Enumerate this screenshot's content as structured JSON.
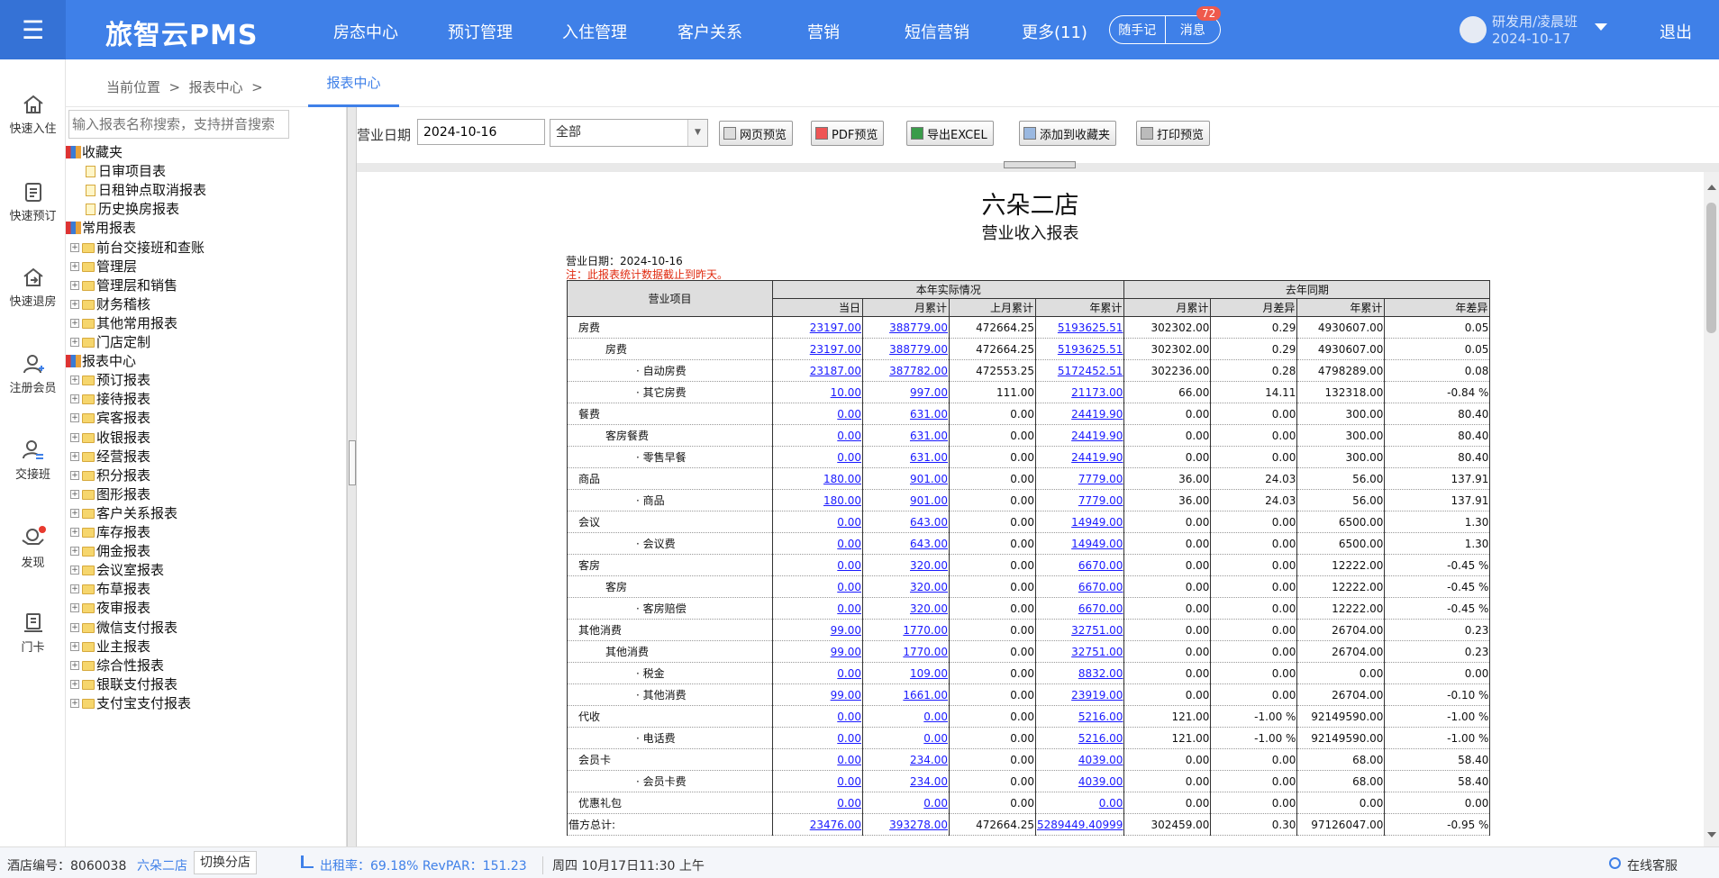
{
  "topbar": {
    "logo": "旅智云PMS",
    "nav": [
      "房态中心",
      "预订管理",
      "入住管理",
      "客户关系",
      "营销",
      "短信营销",
      "更多(11)"
    ],
    "memo_label": "随手记",
    "message_label": "消息",
    "message_count": "72",
    "user_name": "研发用/凌晨班",
    "user_date": "2024-10-17",
    "logout_label": "退出"
  },
  "leftnav": [
    {
      "label": "快速入住",
      "icon": "home-icon"
    },
    {
      "label": "快速预订",
      "icon": "clipboard-icon"
    },
    {
      "label": "快速退房",
      "icon": "checkout-icon"
    },
    {
      "label": "注册会员",
      "icon": "add-user-icon"
    },
    {
      "label": "交接班",
      "icon": "shift-icon"
    },
    {
      "label": "发现",
      "icon": "discover-icon"
    },
    {
      "label": "门卡",
      "icon": "card-icon"
    }
  ],
  "breadcrumb": {
    "text": "当前位置  >  报表中心  >",
    "active_tab": "报表中心"
  },
  "tree": {
    "search_placeholder": "输入报表名称搜索，支持拼音搜索",
    "favorites_label": "收藏夹",
    "favorites": [
      "日审项目表",
      "日租钟点取消报表",
      "历史换房报表"
    ],
    "common_label": "常用报表",
    "common": [
      "前台交接班和查账",
      "管理层",
      "管理层和销售",
      "财务稽核",
      "其他常用报表",
      "门店定制"
    ],
    "center_label": "报表中心",
    "center": [
      "预订报表",
      "接待报表",
      "宾客报表",
      "收银报表",
      "经营报表",
      "积分报表",
      "图形报表",
      "客户关系报表",
      "库存报表",
      "佣金报表",
      "会议室报表",
      "布草报表",
      "夜审报表",
      "微信支付报表",
      "业主报表",
      "综合性报表",
      "银联支付报表",
      "支付宝支付报表"
    ]
  },
  "toolbar": {
    "date_label": "营业日期",
    "date_value": "2024-10-16",
    "select_value": "全部",
    "buttons": [
      "网页预览",
      "PDF预览",
      "导出EXCEL",
      "添加到收藏夹",
      "打印预览"
    ]
  },
  "report": {
    "title": "六朵二店",
    "subtitle": "营业收入报表",
    "date_line": "营业日期：2024-10-16",
    "note": "注：此报表统计数据截止到昨天。",
    "header": {
      "item": "营业项目",
      "current_group": "本年实际情况",
      "last_group": "去年同期",
      "cols": [
        "当日",
        "月累计",
        "上月累计",
        "年累计",
        "月累计",
        "月差异",
        "年累计",
        "年差异"
      ]
    },
    "rows": [
      {
        "label": "房费",
        "indent": 0,
        "v": [
          "23197.00",
          "388779.00",
          "472664.25",
          "5193625.51",
          "302302.00",
          "0.29",
          "4930607.00",
          "0.05"
        ]
      },
      {
        "label": "房费",
        "indent": 1,
        "v": [
          "23197.00",
          "388779.00",
          "472664.25",
          "5193625.51",
          "302302.00",
          "0.29",
          "4930607.00",
          "0.05"
        ]
      },
      {
        "label": "· 自动房费",
        "indent": 2,
        "v": [
          "23187.00",
          "387782.00",
          "472553.25",
          "5172452.51",
          "302236.00",
          "0.28",
          "4798289.00",
          "0.08"
        ]
      },
      {
        "label": "· 其它房费",
        "indent": 2,
        "v": [
          "10.00",
          "997.00",
          "111.00",
          "21173.00",
          "66.00",
          "14.11",
          "132318.00",
          "-0.84 %"
        ]
      },
      {
        "label": "餐费",
        "indent": 0,
        "v": [
          "0.00",
          "631.00",
          "0.00",
          "24419.90",
          "0.00",
          "0.00",
          "300.00",
          "80.40"
        ]
      },
      {
        "label": "客房餐费",
        "indent": 1,
        "v": [
          "0.00",
          "631.00",
          "0.00",
          "24419.90",
          "0.00",
          "0.00",
          "300.00",
          "80.40"
        ]
      },
      {
        "label": "· 零售早餐",
        "indent": 2,
        "v": [
          "0.00",
          "631.00",
          "0.00",
          "24419.90",
          "0.00",
          "0.00",
          "300.00",
          "80.40"
        ]
      },
      {
        "label": "商品",
        "indent": 0,
        "v": [
          "180.00",
          "901.00",
          "0.00",
          "7779.00",
          "36.00",
          "24.03",
          "56.00",
          "137.91"
        ]
      },
      {
        "label": "· 商品",
        "indent": 2,
        "v": [
          "180.00",
          "901.00",
          "0.00",
          "7779.00",
          "36.00",
          "24.03",
          "56.00",
          "137.91"
        ]
      },
      {
        "label": "会议",
        "indent": 0,
        "v": [
          "0.00",
          "643.00",
          "0.00",
          "14949.00",
          "0.00",
          "0.00",
          "6500.00",
          "1.30"
        ]
      },
      {
        "label": "· 会议费",
        "indent": 2,
        "v": [
          "0.00",
          "643.00",
          "0.00",
          "14949.00",
          "0.00",
          "0.00",
          "6500.00",
          "1.30"
        ]
      },
      {
        "label": "客房",
        "indent": 0,
        "v": [
          "0.00",
          "320.00",
          "0.00",
          "6670.00",
          "0.00",
          "0.00",
          "12222.00",
          "-0.45 %"
        ]
      },
      {
        "label": "客房",
        "indent": 1,
        "v": [
          "0.00",
          "320.00",
          "0.00",
          "6670.00",
          "0.00",
          "0.00",
          "12222.00",
          "-0.45 %"
        ]
      },
      {
        "label": "· 客房赔偿",
        "indent": 2,
        "v": [
          "0.00",
          "320.00",
          "0.00",
          "6670.00",
          "0.00",
          "0.00",
          "12222.00",
          "-0.45 %"
        ]
      },
      {
        "label": "其他消费",
        "indent": 0,
        "v": [
          "99.00",
          "1770.00",
          "0.00",
          "32751.00",
          "0.00",
          "0.00",
          "26704.00",
          "0.23"
        ]
      },
      {
        "label": "其他消费",
        "indent": 1,
        "v": [
          "99.00",
          "1770.00",
          "0.00",
          "32751.00",
          "0.00",
          "0.00",
          "26704.00",
          "0.23"
        ]
      },
      {
        "label": "· 税金",
        "indent": 2,
        "v": [
          "0.00",
          "109.00",
          "0.00",
          "8832.00",
          "0.00",
          "0.00",
          "0.00",
          "0.00"
        ]
      },
      {
        "label": "· 其他消费",
        "indent": 2,
        "v": [
          "99.00",
          "1661.00",
          "0.00",
          "23919.00",
          "0.00",
          "0.00",
          "26704.00",
          "-0.10 %"
        ]
      },
      {
        "label": "代收",
        "indent": 0,
        "v": [
          "0.00",
          "0.00",
          "0.00",
          "5216.00",
          "121.00",
          "-1.00 %",
          "92149590.00",
          "-1.00 %"
        ]
      },
      {
        "label": "· 电话费",
        "indent": 2,
        "v": [
          "0.00",
          "0.00",
          "0.00",
          "5216.00",
          "121.00",
          "-1.00 %",
          "92149590.00",
          "-1.00 %"
        ]
      },
      {
        "label": "会员卡",
        "indent": 0,
        "v": [
          "0.00",
          "234.00",
          "0.00",
          "4039.00",
          "0.00",
          "0.00",
          "68.00",
          "58.40"
        ]
      },
      {
        "label": "· 会员卡费",
        "indent": 2,
        "v": [
          "0.00",
          "234.00",
          "0.00",
          "4039.00",
          "0.00",
          "0.00",
          "68.00",
          "58.40"
        ]
      },
      {
        "label": "优惠礼包",
        "indent": 0,
        "v": [
          "0.00",
          "0.00",
          "0.00",
          "0.00",
          "0.00",
          "0.00",
          "0.00",
          "0.00"
        ]
      },
      {
        "label": "借方总计:",
        "indent": -1,
        "v": [
          "23476.00",
          "393278.00",
          "472664.25",
          "5289449.40999",
          "302459.00",
          "0.30",
          "97126047.00",
          "-0.95 %"
        ]
      }
    ]
  },
  "statusbar": {
    "hotel_no": "酒店编号：8060038",
    "hotel_name": "六朵二店",
    "switch": "切换分店",
    "occupancy": "出租率：69.18% RevPAR：151.23",
    "datetime": "周四 10月17日11:30 上午",
    "service": "在线客服"
  }
}
